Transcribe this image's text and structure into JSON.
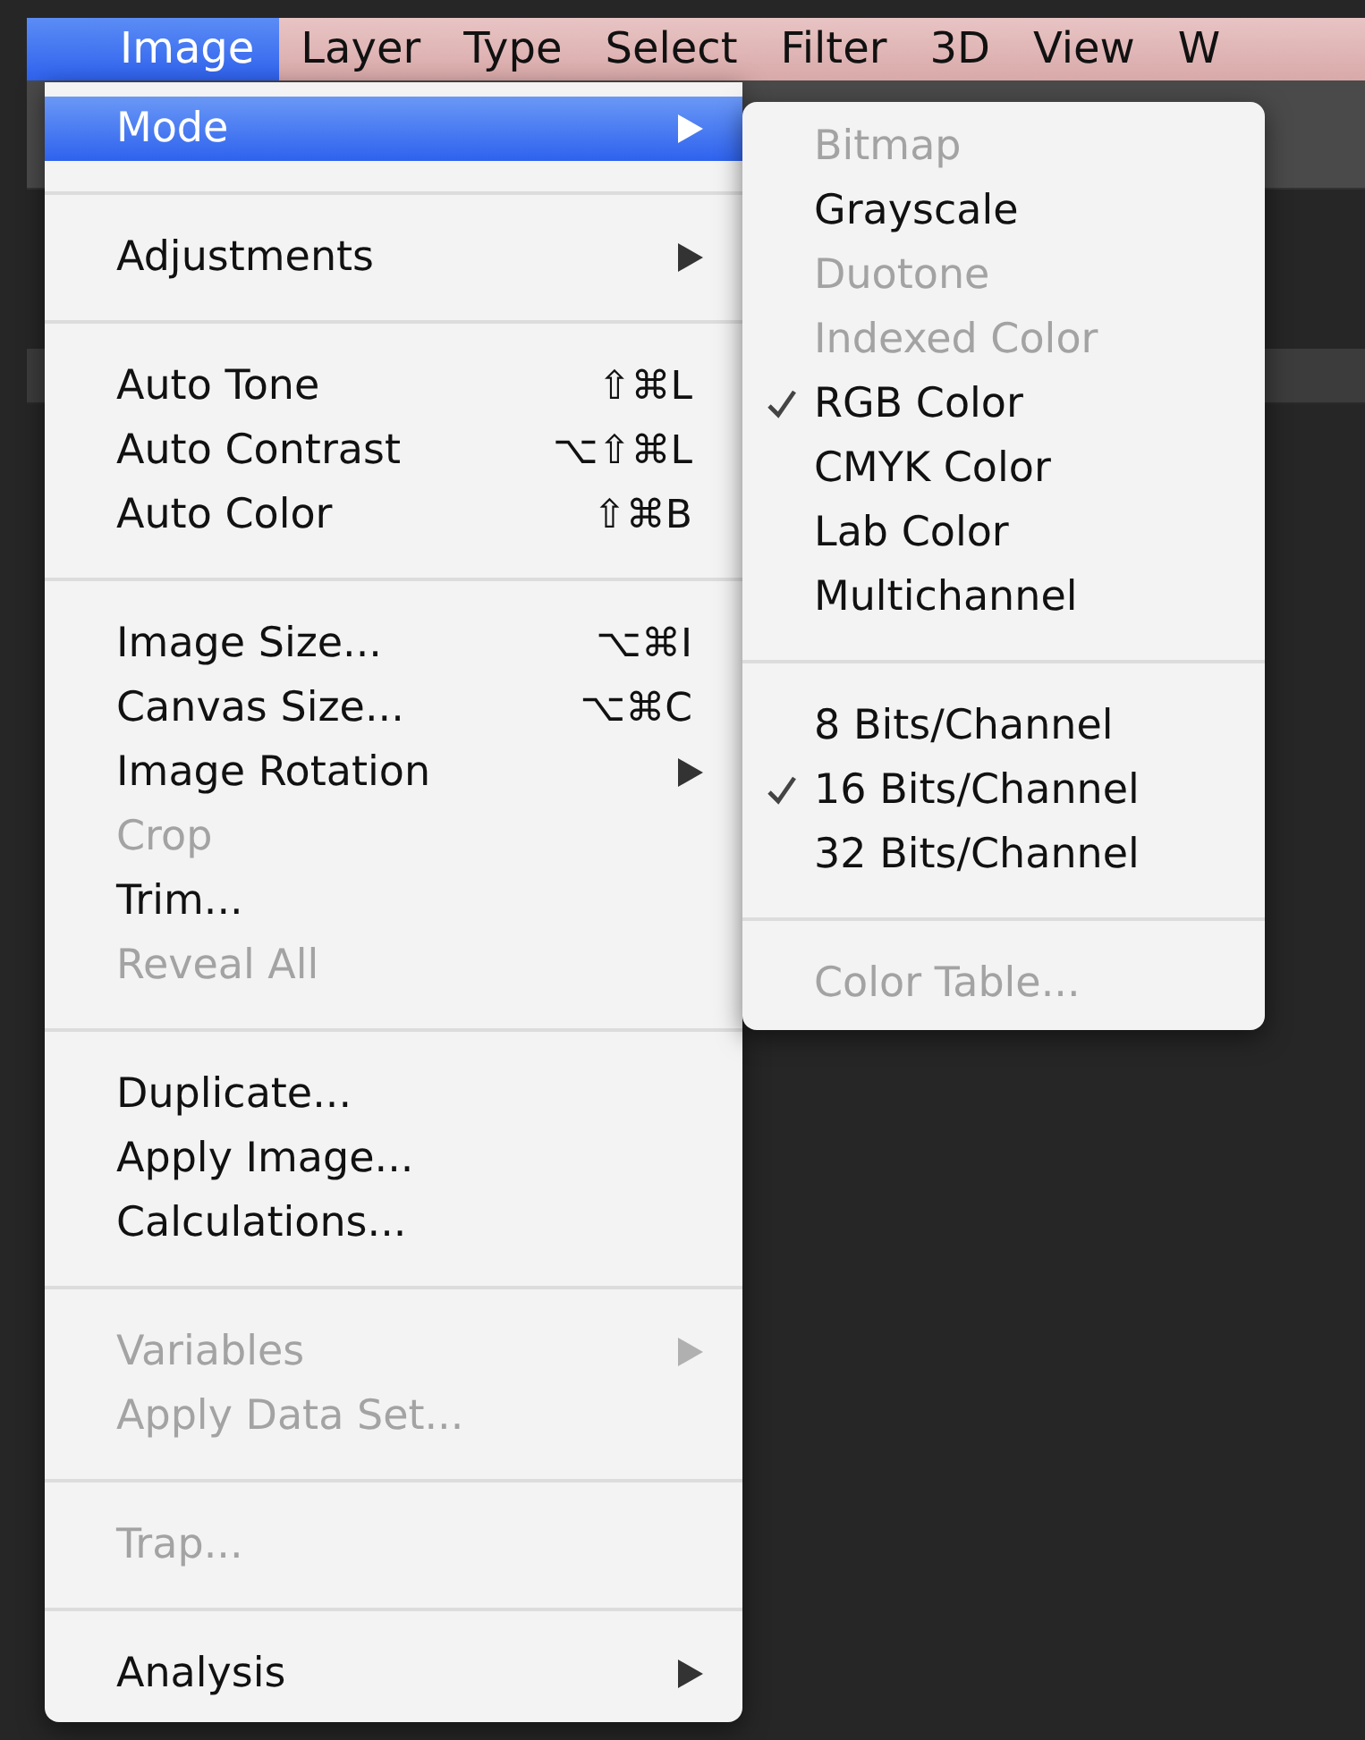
{
  "menubar": [
    {
      "label": "Image",
      "selected": true
    },
    {
      "label": "Layer",
      "selected": false
    },
    {
      "label": "Type",
      "selected": false
    },
    {
      "label": "Select",
      "selected": false
    },
    {
      "label": "Filter",
      "selected": false
    },
    {
      "label": "3D",
      "selected": false
    },
    {
      "label": "View",
      "selected": false
    },
    {
      "label": "W",
      "selected": false
    }
  ],
  "menu": {
    "items": [
      {
        "kind": "item",
        "label": "Mode",
        "submenu": true,
        "selected": true,
        "disabled": false
      },
      {
        "kind": "separator"
      },
      {
        "kind": "item",
        "label": "Adjustments",
        "submenu": true,
        "selected": false,
        "disabled": false
      },
      {
        "kind": "separator"
      },
      {
        "kind": "item",
        "label": "Auto Tone",
        "shortcut": "⇧⌘L",
        "selected": false,
        "disabled": false
      },
      {
        "kind": "item",
        "label": "Auto Contrast",
        "shortcut": "⌥⇧⌘L",
        "selected": false,
        "disabled": false
      },
      {
        "kind": "item",
        "label": "Auto Color",
        "shortcut": "⇧⌘B",
        "selected": false,
        "disabled": false
      },
      {
        "kind": "separator"
      },
      {
        "kind": "item",
        "label": "Image Size...",
        "shortcut": "⌥⌘I",
        "selected": false,
        "disabled": false
      },
      {
        "kind": "item",
        "label": "Canvas Size...",
        "shortcut": "⌥⌘C",
        "selected": false,
        "disabled": false
      },
      {
        "kind": "item",
        "label": "Image Rotation",
        "submenu": true,
        "selected": false,
        "disabled": false
      },
      {
        "kind": "item",
        "label": "Crop",
        "selected": false,
        "disabled": true
      },
      {
        "kind": "item",
        "label": "Trim...",
        "selected": false,
        "disabled": false
      },
      {
        "kind": "item",
        "label": "Reveal All",
        "selected": false,
        "disabled": true
      },
      {
        "kind": "separator"
      },
      {
        "kind": "item",
        "label": "Duplicate...",
        "selected": false,
        "disabled": false
      },
      {
        "kind": "item",
        "label": "Apply Image...",
        "selected": false,
        "disabled": false
      },
      {
        "kind": "item",
        "label": "Calculations...",
        "selected": false,
        "disabled": false
      },
      {
        "kind": "separator"
      },
      {
        "kind": "item",
        "label": "Variables",
        "submenu": true,
        "selected": false,
        "disabled": true
      },
      {
        "kind": "item",
        "label": "Apply Data Set...",
        "selected": false,
        "disabled": true
      },
      {
        "kind": "separator"
      },
      {
        "kind": "item",
        "label": "Trap...",
        "selected": false,
        "disabled": true
      },
      {
        "kind": "separator"
      },
      {
        "kind": "item",
        "label": "Analysis",
        "submenu": true,
        "selected": false,
        "disabled": false
      }
    ]
  },
  "submenu": {
    "items": [
      {
        "kind": "item",
        "label": "Bitmap",
        "checked": false,
        "disabled": true
      },
      {
        "kind": "item",
        "label": "Grayscale",
        "checked": false,
        "disabled": false
      },
      {
        "kind": "item",
        "label": "Duotone",
        "checked": false,
        "disabled": true
      },
      {
        "kind": "item",
        "label": "Indexed Color",
        "checked": false,
        "disabled": true
      },
      {
        "kind": "item",
        "label": "RGB Color",
        "checked": true,
        "disabled": false
      },
      {
        "kind": "item",
        "label": "CMYK Color",
        "checked": false,
        "disabled": false
      },
      {
        "kind": "item",
        "label": "Lab Color",
        "checked": false,
        "disabled": false
      },
      {
        "kind": "item",
        "label": "Multichannel",
        "checked": false,
        "disabled": false
      },
      {
        "kind": "separator"
      },
      {
        "kind": "item",
        "label": "8 Bits/Channel",
        "checked": false,
        "disabled": false
      },
      {
        "kind": "item",
        "label": "16 Bits/Channel",
        "checked": true,
        "disabled": false
      },
      {
        "kind": "item",
        "label": "32 Bits/Channel",
        "checked": false,
        "disabled": false
      },
      {
        "kind": "separator"
      },
      {
        "kind": "item",
        "label": "Color Table...",
        "checked": false,
        "disabled": true
      }
    ]
  }
}
